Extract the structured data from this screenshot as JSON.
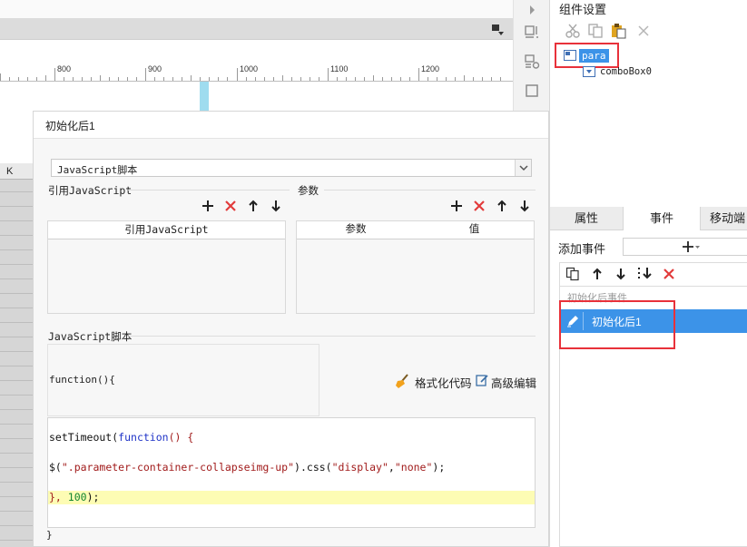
{
  "ruler": {
    "labels": [
      "800",
      "900",
      "1000",
      "1100",
      "1200"
    ]
  },
  "grid": {
    "header": "K"
  },
  "dialog": {
    "title": "初始化后1",
    "script_type": "JavaScript脚本",
    "ref_js_label": "引用JavaScript",
    "params_label": "参数",
    "ref_js_column": "引用JavaScript",
    "params_columns": [
      "参数",
      "值"
    ],
    "script_section_label": "JavaScript脚本",
    "function_signature": "function(){",
    "format_code_label": "格式化代码",
    "advanced_edit_label": "高级编辑",
    "code": {
      "line1": [
        "setTimeout(",
        "function",
        "() {"
      ],
      "line2": [
        "$(",
        "\".parameter-container-collapseimg-up\"",
        ").css(",
        "\"display\"",
        ",",
        "\"none\"",
        ");"
      ],
      "line3": [
        "}, ",
        "100",
        ");"
      ]
    },
    "function_close": "}"
  },
  "right_panel": {
    "title": "组件设置",
    "tree_root": "para",
    "tree_child": "comboBox0",
    "tabs": [
      "属性",
      "事件",
      "移动端"
    ],
    "add_event_label": "添加事件",
    "event_group": "初始化后事件",
    "event_item": "初始化后1"
  },
  "colors": {
    "selection_blue": "#3c93e8",
    "highlight_red": "#e8313a",
    "delete_red": "#e23b3b"
  },
  "icons": [
    "cut-icon",
    "copy-icon",
    "paste-icon",
    "close-icon",
    "plus-icon",
    "delete-icon",
    "arrow-up-icon",
    "arrow-down-icon",
    "broom-icon",
    "edit-icon",
    "pencil-icon"
  ]
}
